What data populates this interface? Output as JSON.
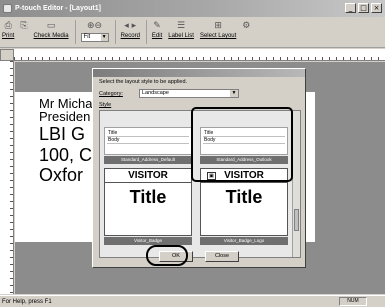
{
  "window": {
    "title": "P-touch Editor - [Layout1]"
  },
  "titlebar_buttons": [
    "_",
    "□",
    "×"
  ],
  "toolbar": {
    "print_label": "Print",
    "check_media_label": "Check Media",
    "zoom_value": "Fit",
    "record_label": "Record",
    "edit_label": "Edit",
    "label_list_label": "Label List",
    "select_layout_label": "Select Layout"
  },
  "page": {
    "lines": [
      "Mr Micha",
      "Presiden",
      "LBI G",
      "100, C",
      "Oxfor"
    ]
  },
  "dialog": {
    "prompt": "Select the layout style to be applied.",
    "category_label": "Category:",
    "category_value": "Landscape",
    "style_label": "Style",
    "templates": [
      {
        "line1": "Title",
        "line2": "Body",
        "name": "Standard_Address_Default"
      },
      {
        "line1": "Title",
        "line2": "Body",
        "name": "Standard_Address_Outlook"
      }
    ],
    "badges": [
      {
        "heading": "VISITOR",
        "title": "Title",
        "name": "Visitor_Badge"
      },
      {
        "heading": "VISITOR",
        "title": "Title",
        "name": "Visitor_Badge_Logo"
      }
    ],
    "ok_label": "OK",
    "close_label": "Close"
  },
  "statusbar": {
    "text": "For Help, press F1",
    "num": "NUM"
  }
}
